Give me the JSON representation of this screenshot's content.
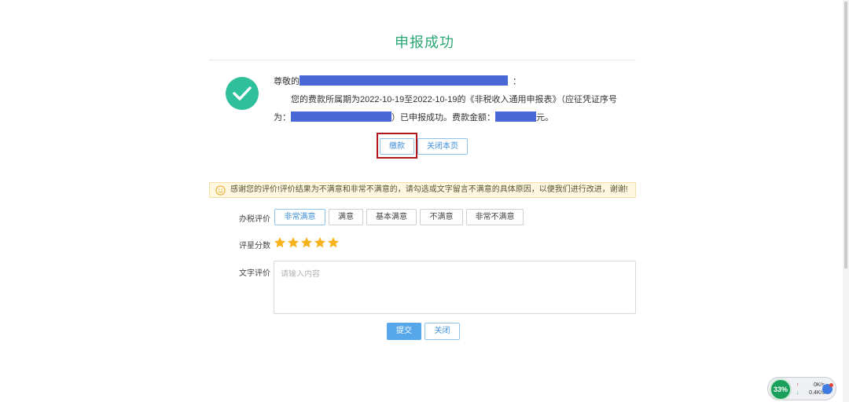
{
  "page": {
    "title": "申报成功"
  },
  "message": {
    "salutation": "尊敬的",
    "salutation_end": "：",
    "line2": "您的费款所属期为2022-10-19至2022-10-19的《非税收入通用申报表》（应征凭证序号",
    "line3_prefix": "为：",
    "line3_mid": "）已申报成功。费款金额：",
    "line3_suffix": "元。"
  },
  "actions": {
    "pay_label": "缴款",
    "close_page_label": "关闭本页"
  },
  "notice": {
    "text": "感谢您的评价!评价结果为不满意和非常不满意的，请勾选或文字留言不满意的具体原因，以便我们进行改进，谢谢!"
  },
  "rating": {
    "label": "办税评价",
    "options": [
      "非常满意",
      "满意",
      "基本满意",
      "不满意",
      "非常不满意"
    ],
    "selected": "非常满意"
  },
  "score": {
    "label": "评星分数",
    "stars": 5,
    "max": 5,
    "color": "#f6b21a"
  },
  "comment": {
    "label": "文字评价",
    "placeholder": "请输入内容"
  },
  "form": {
    "submit_label": "提交",
    "close_label": "关闭"
  },
  "widget": {
    "percent": "33%",
    "up_speed": "0K/s",
    "down_speed": "0.4K/s"
  },
  "colors": {
    "success_green": "#2aa773",
    "mask_blue": "#4a67d6",
    "accent_blue": "#56a7ea",
    "highlight_red": "#b0161c"
  }
}
